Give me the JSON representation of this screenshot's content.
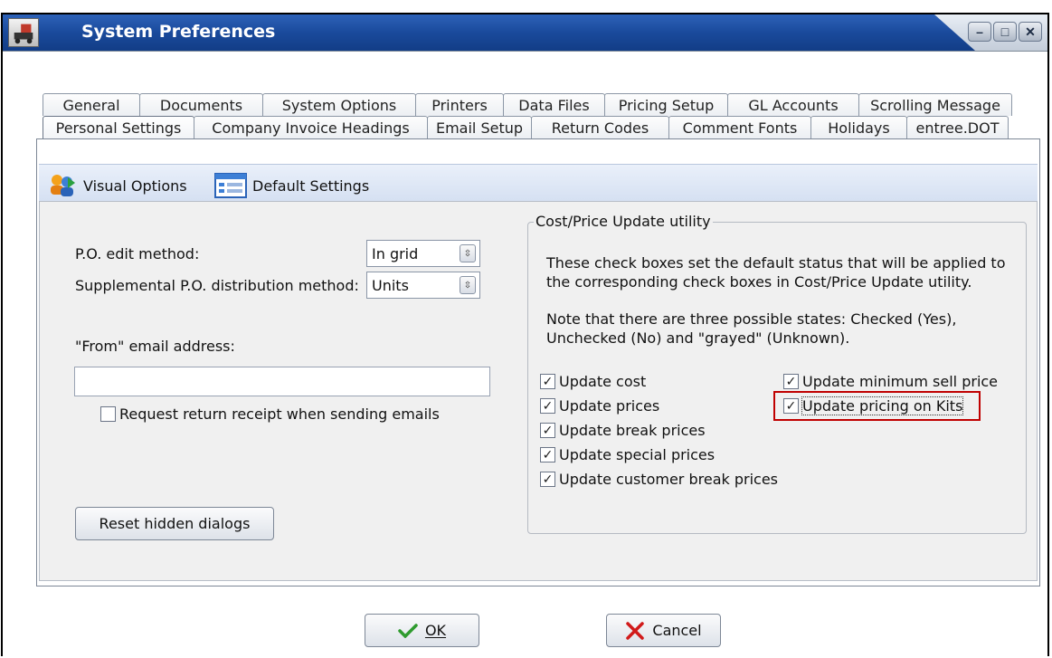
{
  "window": {
    "title": "System Preferences"
  },
  "tabs_row1": [
    "General",
    "Documents",
    "System Options",
    "Printers",
    "Data Files",
    "Pricing Setup",
    "GL Accounts",
    "Scrolling Message"
  ],
  "tabs_row2": [
    "Personal Settings",
    "Company Invoice Headings",
    "Email Setup",
    "Return Codes",
    "Comment Fonts",
    "Holidays",
    "entree.DOT"
  ],
  "active_tab": "Personal Settings",
  "subbar": {
    "visual_options": "Visual Options",
    "default_settings": "Default Settings"
  },
  "left": {
    "po_edit_label": "P.O. edit method:",
    "po_edit_value": "In grid",
    "supp_label": "Supplemental P.O. distribution method:",
    "supp_value": "Units",
    "email_label": "\"From\" email address:",
    "email_value": "",
    "receipt_label": "Request return receipt when sending emails",
    "receipt_checked": false,
    "reset_button": "Reset hidden dialogs"
  },
  "group": {
    "title": "Cost/Price Update utility",
    "desc1": "These check boxes set the default status that will be applied to",
    "desc2": "the corresponding check boxes in Cost/Price Update utility.",
    "note1": "Note that there are three possible states: Checked (Yes),",
    "note2": "Unchecked (No) and \"grayed\" (Unknown).",
    "update_cost": "Update cost",
    "update_prices": "Update prices",
    "update_break": "Update break prices",
    "update_special": "Update special prices",
    "update_customer_break": "Update customer break prices",
    "update_min_sell": "Update minimum sell price",
    "update_kits": "Update pricing on Kits"
  },
  "buttons": {
    "ok": "OK",
    "cancel": "Cancel"
  },
  "colors": {
    "title_blue": "#1a4a9c",
    "highlight": "#c00000",
    "ok_green": "#2e9b2e",
    "cancel_red": "#d11a1a"
  },
  "icons": [
    "app-icon",
    "minimize-icon",
    "restore-icon",
    "close-icon",
    "visual-options-icon",
    "default-settings-icon",
    "check-icon",
    "x-icon",
    "combo-arrow-icon"
  ]
}
